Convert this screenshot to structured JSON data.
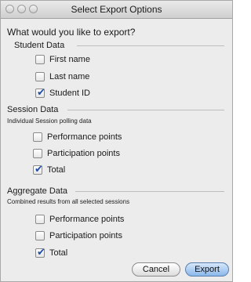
{
  "window": {
    "title": "Select Export Options"
  },
  "prompt": "What would you like to export?",
  "student_data": {
    "heading": "Student Data",
    "items": [
      {
        "label": "First name",
        "checked": false
      },
      {
        "label": "Last name",
        "checked": false
      },
      {
        "label": "Student ID",
        "checked": true
      }
    ]
  },
  "session_data": {
    "heading": "Session Data",
    "subtitle": "Individual Session polling data",
    "items": [
      {
        "label": "Performance points",
        "checked": false
      },
      {
        "label": "Participation points",
        "checked": false
      },
      {
        "label": "Total",
        "checked": true
      }
    ]
  },
  "aggregate_data": {
    "heading": "Aggregate Data",
    "subtitle": "Combined results from all selected sessions",
    "items": [
      {
        "label": "Performance points",
        "checked": false
      },
      {
        "label": "Participation points",
        "checked": false
      },
      {
        "label": "Total",
        "checked": true
      }
    ]
  },
  "buttons": {
    "cancel": "Cancel",
    "export": "Export"
  },
  "colors": {
    "checkmark": "#1f4fa8",
    "default_button": "#8ab8ea"
  }
}
